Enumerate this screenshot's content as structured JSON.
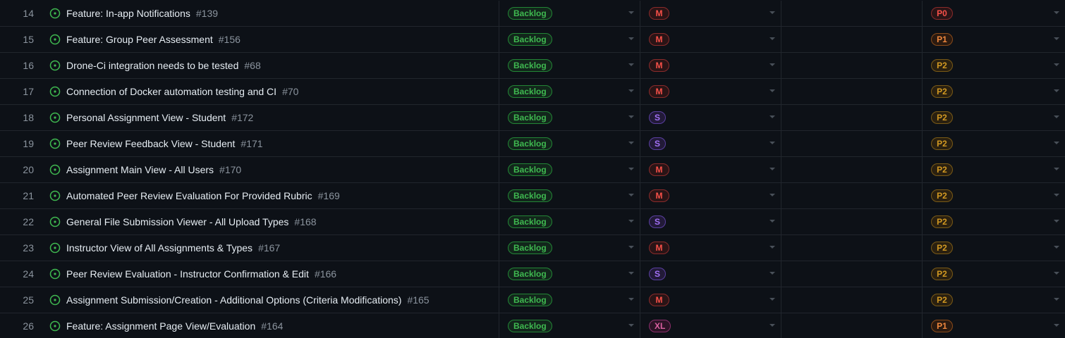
{
  "colors": {
    "background": "#0d1117",
    "border": "#21262d",
    "open_issue": "#3fb950",
    "text": "#e6edf3",
    "muted": "#8b949e"
  },
  "rows": [
    {
      "index": "14",
      "title": "Feature: In-app Notifications",
      "number": "#139",
      "status": "Backlog",
      "size": "M",
      "priority": "P0"
    },
    {
      "index": "15",
      "title": "Feature: Group Peer Assessment",
      "number": "#156",
      "status": "Backlog",
      "size": "M",
      "priority": "P1"
    },
    {
      "index": "16",
      "title": "Drone-Ci integration needs to be tested",
      "number": "#68",
      "status": "Backlog",
      "size": "M",
      "priority": "P2"
    },
    {
      "index": "17",
      "title": "Connection of Docker automation testing and CI",
      "number": "#70",
      "status": "Backlog",
      "size": "M",
      "priority": "P2"
    },
    {
      "index": "18",
      "title": "Personal Assignment View - Student",
      "number": "#172",
      "status": "Backlog",
      "size": "S",
      "priority": "P2"
    },
    {
      "index": "19",
      "title": "Peer Review Feedback View - Student",
      "number": "#171",
      "status": "Backlog",
      "size": "S",
      "priority": "P2"
    },
    {
      "index": "20",
      "title": "Assignment Main View - All Users",
      "number": "#170",
      "status": "Backlog",
      "size": "M",
      "priority": "P2"
    },
    {
      "index": "21",
      "title": "Automated Peer Review Evaluation For Provided Rubric",
      "number": "#169",
      "status": "Backlog",
      "size": "M",
      "priority": "P2"
    },
    {
      "index": "22",
      "title": "General File Submission Viewer - All Upload Types",
      "number": "#168",
      "status": "Backlog",
      "size": "S",
      "priority": "P2"
    },
    {
      "index": "23",
      "title": "Instructor View of All Assignments & Types",
      "number": "#167",
      "status": "Backlog",
      "size": "M",
      "priority": "P2"
    },
    {
      "index": "24",
      "title": "Peer Review Evaluation - Instructor Confirmation & Edit",
      "number": "#166",
      "status": "Backlog",
      "size": "S",
      "priority": "P2"
    },
    {
      "index": "25",
      "title": "Assignment Submission/Creation - Additional Options (Criteria Modifications)",
      "number": "#165",
      "status": "Backlog",
      "size": "M",
      "priority": "P2"
    },
    {
      "index": "26",
      "title": "Feature: Assignment Page View/Evaluation",
      "number": "#164",
      "status": "Backlog",
      "size": "XL",
      "priority": "P1"
    }
  ],
  "row_icon": "issue-opened-icon",
  "dropdown_icon": "caret-down-icon"
}
